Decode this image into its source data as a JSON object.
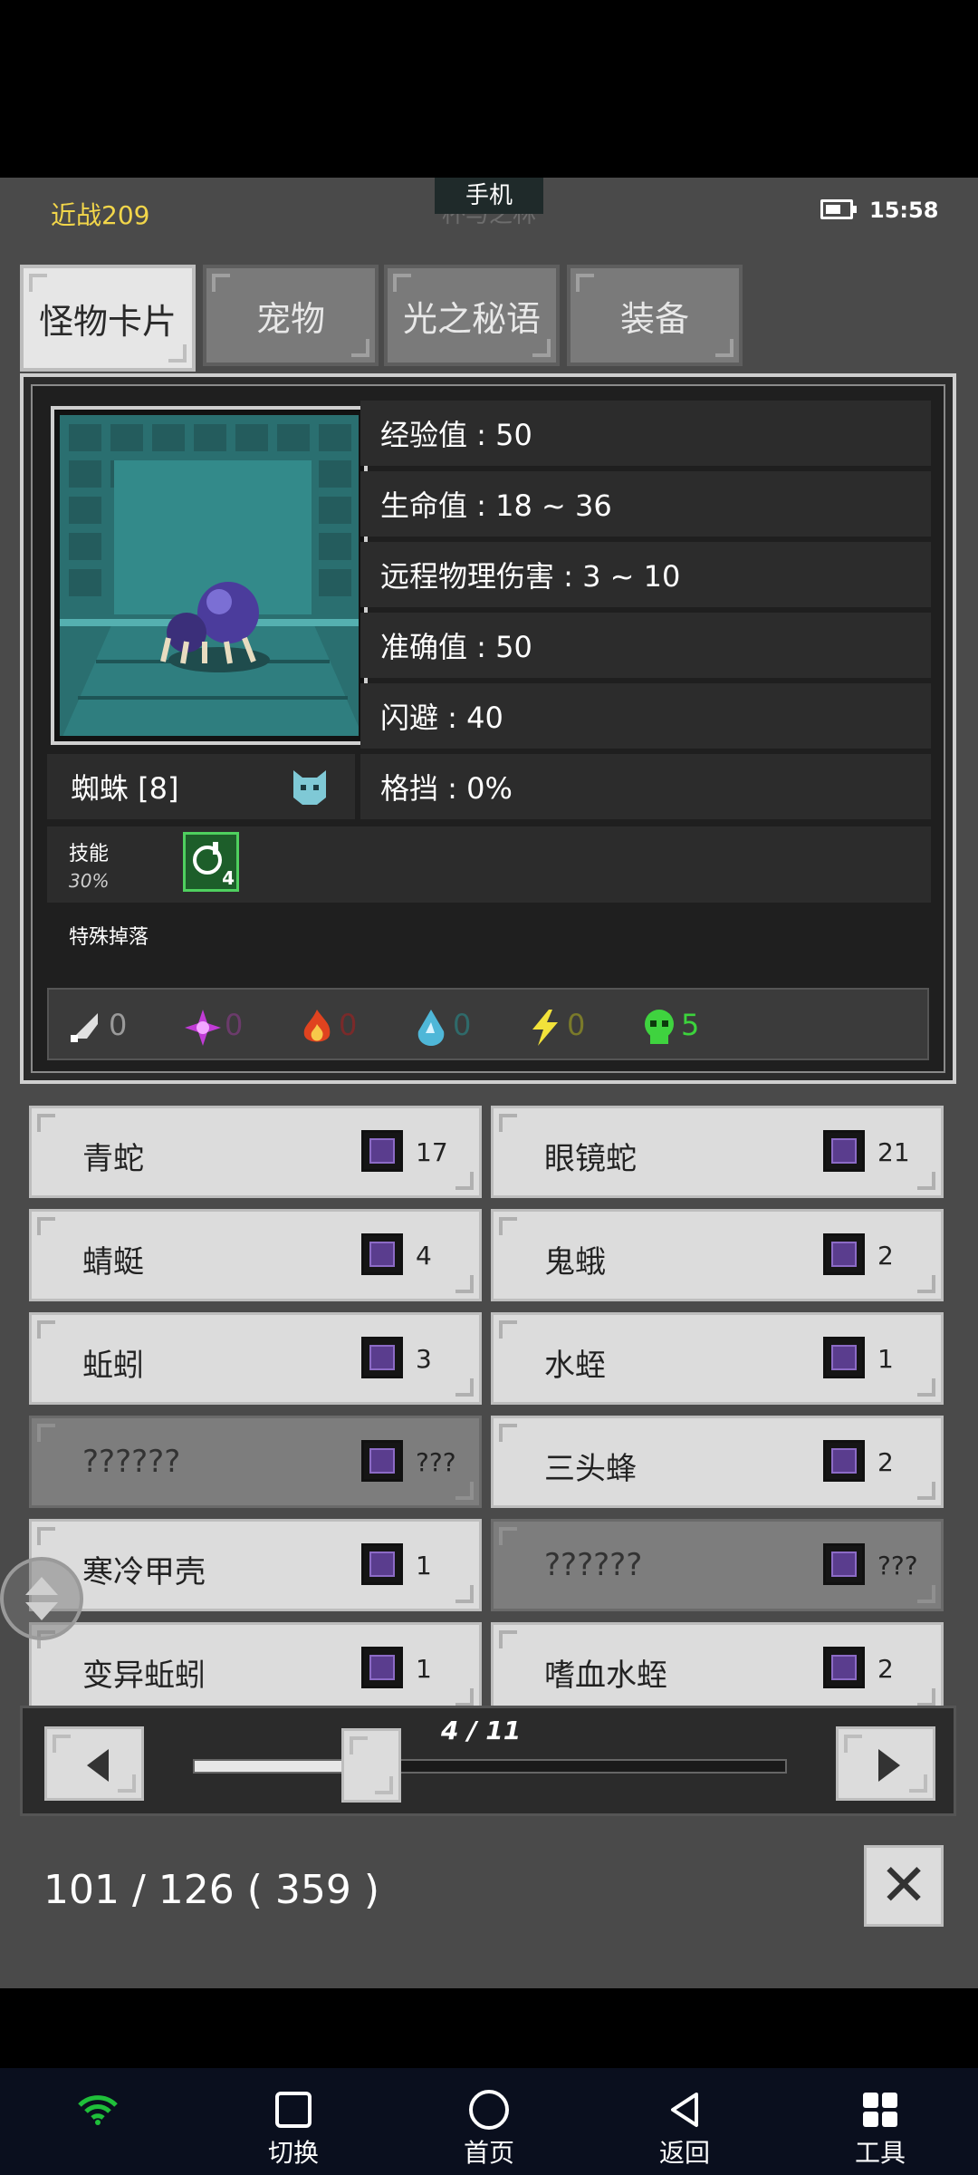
{
  "status_bar": {
    "left_text": "近战209",
    "center_label": "手机",
    "center_shadow_text": "杯与之林",
    "time": "15:58"
  },
  "tabs": [
    {
      "label": "怪物卡片",
      "active": true
    },
    {
      "label": "宠物",
      "active": false
    },
    {
      "label": "光之秘语",
      "active": false
    },
    {
      "label": "装备",
      "active": false
    }
  ],
  "monster": {
    "name": "蜘蛛 [8]",
    "stats": [
      {
        "label": "经验值 : 50"
      },
      {
        "label": "生命值 : 18 ~ 36"
      },
      {
        "label": "远程物理伤害 : 3 ~ 10"
      },
      {
        "label": "准确值 : 50"
      },
      {
        "label": "闪避 : 40"
      },
      {
        "label": "格挡 : 0%"
      }
    ],
    "skill_label": "技能",
    "skill_chance": "30%",
    "skill_level": "4",
    "special_drop_label": "特殊掉落",
    "elements": [
      {
        "name": "physical-icon",
        "value": "0",
        "color": "#9a9a9a"
      },
      {
        "name": "arcane-icon",
        "value": "0",
        "color": "#6b3b6b"
      },
      {
        "name": "fire-icon",
        "value": "0",
        "color": "#7a2a2a"
      },
      {
        "name": "water-icon",
        "value": "0",
        "color": "#2f6a6a"
      },
      {
        "name": "lightning-icon",
        "value": "0",
        "color": "#7a7a2a"
      },
      {
        "name": "poison-icon",
        "value": "5",
        "color": "#3cd33c"
      }
    ]
  },
  "cards": [
    {
      "name": "青蛇",
      "count": "17",
      "known": true
    },
    {
      "name": "眼镜蛇",
      "count": "21",
      "known": true
    },
    {
      "name": "蜻蜓",
      "count": "4",
      "known": true
    },
    {
      "name": "鬼蛾",
      "count": "2",
      "known": true
    },
    {
      "name": "蚯蚓",
      "count": "3",
      "known": true
    },
    {
      "name": "水蛭",
      "count": "1",
      "known": true
    },
    {
      "name": "??????",
      "count": "???",
      "known": false
    },
    {
      "name": "三头蜂",
      "count": "2",
      "known": true
    },
    {
      "name": "寒冷甲壳",
      "count": "1",
      "known": true
    },
    {
      "name": "??????",
      "count": "???",
      "known": false
    },
    {
      "name": "变异蚯蚓",
      "count": "1",
      "known": true
    },
    {
      "name": "嗜血水蛭",
      "count": "2",
      "known": true
    }
  ],
  "pager": {
    "page_label": "4 / 11",
    "progress": 0.3
  },
  "footer": {
    "count_text": "101 / 126 ( 359 )"
  },
  "navbar": {
    "items": [
      {
        "label": "",
        "icon": "wifi-icon"
      },
      {
        "label": "切换",
        "icon": "square-icon"
      },
      {
        "label": "首页",
        "icon": "circle-icon"
      },
      {
        "label": "返回",
        "icon": "back-triangle-icon"
      },
      {
        "label": "工具",
        "icon": "grid-icon"
      }
    ]
  }
}
